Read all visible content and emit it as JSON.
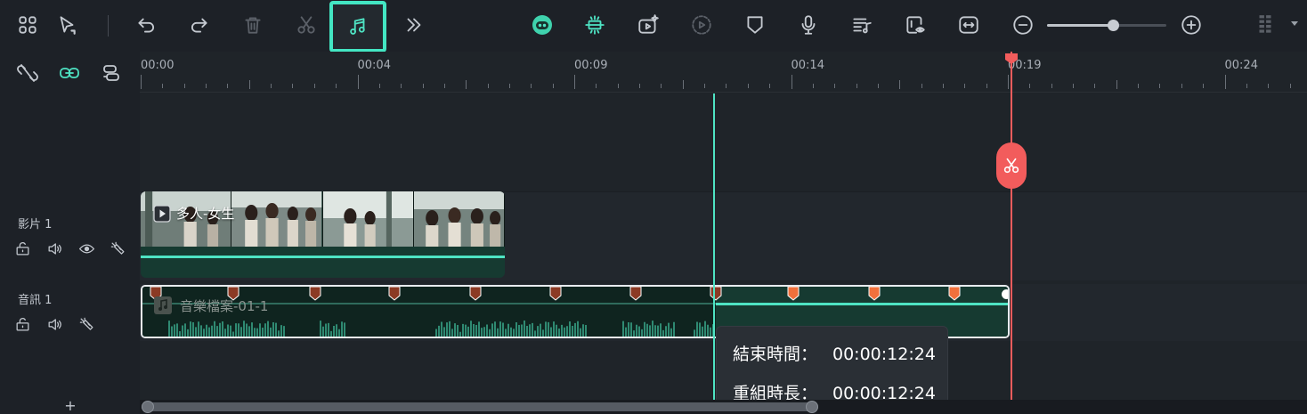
{
  "toolbar": {
    "buttons": [
      {
        "id": "grid",
        "icon": "layout-grid-icon"
      },
      {
        "id": "select",
        "icon": "selection-cursor-icon"
      },
      {
        "id": "undo",
        "icon": "undo-icon"
      },
      {
        "id": "redo",
        "icon": "redo-icon"
      },
      {
        "id": "delete",
        "icon": "trash-icon",
        "enabled": false
      },
      {
        "id": "cut",
        "icon": "scissors-icon",
        "enabled": false
      },
      {
        "id": "beat-sync",
        "icon": "music-beat-icon",
        "active": true
      },
      {
        "id": "more",
        "icon": "double-chevron-right-icon"
      },
      {
        "id": "ai-mascot",
        "icon": "ai-robot-icon"
      },
      {
        "id": "auto-reframe",
        "icon": "auto-reframe-icon"
      },
      {
        "id": "ai-video",
        "icon": "ai-video-sparkle-icon"
      },
      {
        "id": "render",
        "icon": "render-preview-icon",
        "enabled": false
      },
      {
        "id": "marker",
        "icon": "marker-shield-icon"
      },
      {
        "id": "voiceover",
        "icon": "microphone-icon"
      },
      {
        "id": "audio-track",
        "icon": "music-list-icon"
      },
      {
        "id": "preview-settings",
        "icon": "preview-eye-icon"
      },
      {
        "id": "fit",
        "icon": "fit-to-window-icon"
      },
      {
        "id": "zoom-out",
        "icon": "zoom-out-icon"
      },
      {
        "id": "zoom-in",
        "icon": "zoom-in-icon"
      }
    ],
    "zoom_level": 0.55
  },
  "track_controls": {
    "unlink": "unlink-icon",
    "link": "link-icon",
    "track-manage": "track-manage-icon"
  },
  "ruler": {
    "labels": [
      "00:00",
      "00:04",
      "00:09",
      "00:14",
      "00:19",
      "00:24"
    ]
  },
  "tracks": {
    "video": {
      "label": "影片 1",
      "clip_title": "多人-女生"
    },
    "audio": {
      "label": "音訊 1",
      "clip_title": "音樂檔案-01-1"
    }
  },
  "tooltip": {
    "end_time_label": "結束時間：",
    "end_time_value": "00:00:12:24",
    "duration_label": "重組時長：",
    "duration_value": "00:00:12:24"
  },
  "add_track_label": "+",
  "colors": {
    "accent": "#4ee3c3",
    "playhead": "#f25c5c",
    "beat_marker_past": "#8b3a24",
    "beat_marker_future": "#f0703c"
  }
}
